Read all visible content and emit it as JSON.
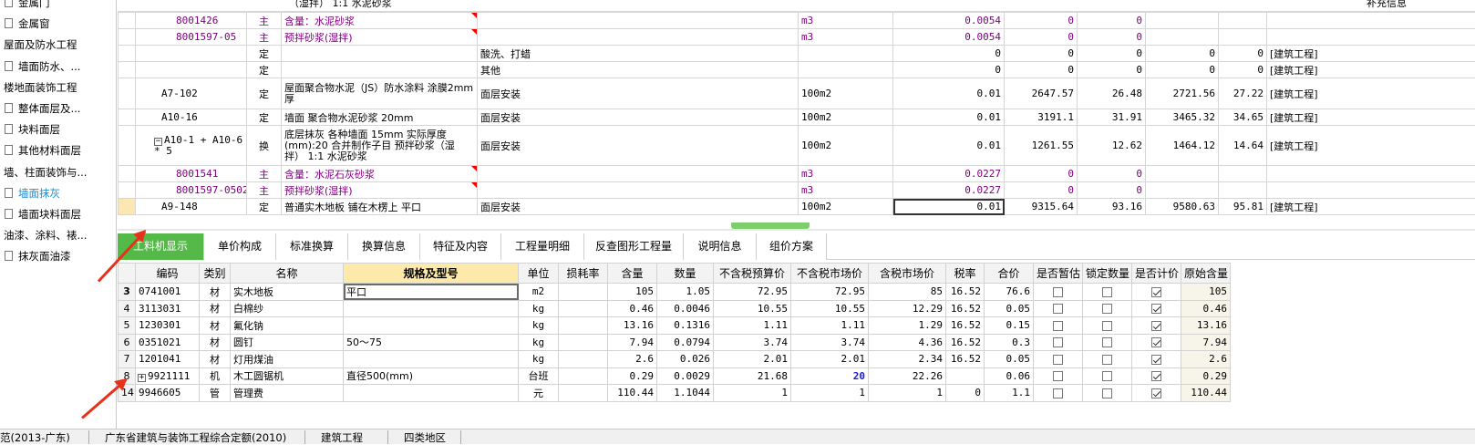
{
  "sidebar": {
    "items": [
      {
        "label": "金属门",
        "icon": true,
        "indent": true,
        "active": false
      },
      {
        "label": "金属窗",
        "icon": true,
        "indent": true,
        "active": false
      },
      {
        "label": "屋面及防水工程",
        "icon": false,
        "indent": false,
        "active": false
      },
      {
        "label": "墙面防水、...",
        "icon": true,
        "indent": true,
        "active": false
      },
      {
        "label": "楼地面装饰工程",
        "icon": false,
        "indent": false,
        "active": false
      },
      {
        "label": "整体面层及...",
        "icon": true,
        "indent": true,
        "active": false
      },
      {
        "label": "块料面层",
        "icon": true,
        "indent": true,
        "active": false
      },
      {
        "label": "其他材料面层",
        "icon": true,
        "indent": true,
        "active": false
      },
      {
        "label": "墙、柱面装饰与...",
        "icon": false,
        "indent": false,
        "active": false
      },
      {
        "label": "墙面抹灰",
        "icon": true,
        "indent": true,
        "active": true
      },
      {
        "label": "墙面块料面层",
        "icon": true,
        "indent": true,
        "active": false
      },
      {
        "label": "油漆、涂料、裱...",
        "icon": false,
        "indent": false,
        "active": false
      },
      {
        "label": "抹灰面油漆",
        "icon": true,
        "indent": true,
        "active": false
      }
    ]
  },
  "quota_grid": {
    "top_partial_text": "（湿拌） 1:1 水泥砂浆",
    "top_right_partial": "补充信息",
    "rows": [
      {
        "code": "8001426",
        "type": "主",
        "name": "含量：水泥砂浆",
        "feature": "",
        "unit": "m3",
        "qty": "0.0054",
        "price": "0",
        "sum": "0",
        "c1": "",
        "c2": "",
        "cat": "",
        "mat": true
      },
      {
        "code": "8001597-05",
        "type": "主",
        "name": "预拌砂浆(湿拌)",
        "feature": "",
        "unit": "m3",
        "qty": "0.0054",
        "price": "0",
        "sum": "0",
        "c1": "",
        "c2": "",
        "cat": "",
        "mat": true
      },
      {
        "code": "",
        "type": "定",
        "name": "",
        "feature": "酸洗、打蜡",
        "unit": "",
        "qty": "0",
        "price": "0",
        "sum": "0",
        "c1": "0",
        "c2": "0",
        "cat": "[建筑工程]",
        "mat": false
      },
      {
        "code": "",
        "type": "定",
        "name": "",
        "feature": "其他",
        "unit": "",
        "qty": "0",
        "price": "0",
        "sum": "0",
        "c1": "0",
        "c2": "0",
        "cat": "[建筑工程]",
        "mat": false
      },
      {
        "code": "A7-102",
        "type": "定",
        "name": "屋面聚合物水泥（JS）防水涂料 涂膜2mm厚",
        "feature": "面层安装",
        "unit": "100m2",
        "qty": "0.01",
        "price": "2647.57",
        "sum": "26.48",
        "c1": "2721.56",
        "c2": "27.22",
        "cat": "[建筑工程]",
        "mat": false
      },
      {
        "code": "A10-16",
        "type": "定",
        "name": "墙面 聚合物水泥砂浆 20mm",
        "feature": "面层安装",
        "unit": "100m2",
        "qty": "0.01",
        "price": "3191.1",
        "sum": "31.91",
        "c1": "3465.32",
        "c2": "34.65",
        "cat": "[建筑工程]",
        "mat": false
      },
      {
        "code": "A10-1 + A10-6 * 5",
        "type": "换",
        "name": "底层抹灰 各种墙面 15mm 实际厚度(mm):20 合并制作子目 预拌砂浆（湿拌） 1:1 水泥砂浆",
        "feature": "面层安装",
        "unit": "100m2",
        "qty": "0.01",
        "price": "1261.55",
        "sum": "12.62",
        "c1": "1464.12",
        "c2": "14.64",
        "cat": "[建筑工程]",
        "mat": false
      },
      {
        "code": "8001541",
        "type": "主",
        "name": "含量：水泥石灰砂浆",
        "feature": "",
        "unit": "m3",
        "qty": "0.0227",
        "price": "0",
        "sum": "0",
        "c1": "",
        "c2": "",
        "cat": "",
        "mat": true
      },
      {
        "code": "8001597-0502",
        "type": "主",
        "name": "预拌砂浆(湿拌)",
        "feature": "",
        "unit": "m3",
        "qty": "0.0227",
        "price": "0",
        "sum": "0",
        "c1": "",
        "c2": "",
        "cat": "",
        "mat": true
      },
      {
        "code": "A9-148",
        "type": "定",
        "name": "普通实木地板 铺在木楞上 平口",
        "feature": "面层安装",
        "unit": "100m2",
        "qty": "0.01",
        "price": "9315.64",
        "sum": "93.16",
        "c1": "9580.63",
        "c2": "95.81",
        "cat": "[建筑工程]",
        "mat": false
      }
    ]
  },
  "tabs": [
    "工料机显示",
    "单价构成",
    "标准换算",
    "换算信息",
    "特征及内容",
    "工程量明细",
    "反查图形工程量",
    "说明信息",
    "组价方案"
  ],
  "resource_table": {
    "headers": [
      "",
      "编码",
      "类别",
      "名称",
      "规格及型号",
      "单位",
      "损耗率",
      "含量",
      "数量",
      "不含税预算价",
      "不含税市场价",
      "含税市场价",
      "税率",
      "合价",
      "是否暂估",
      "锁定数量",
      "是否计价",
      "原始含量"
    ],
    "rows": [
      {
        "n": "3",
        "code": "0741001",
        "cat": "材",
        "name": "实木地板",
        "spec": "平口",
        "unit": "m2",
        "loss": "",
        "content": "105",
        "qty": "1.05",
        "budget": "72.95",
        "market": "72.95",
        "taxm": "85",
        "tax": "16.52",
        "total": "76.6",
        "est": false,
        "lock": false,
        "priced": true,
        "orig": "105"
      },
      {
        "n": "4",
        "code": "3113031",
        "cat": "材",
        "name": "白棉纱",
        "spec": "",
        "unit": "kg",
        "loss": "",
        "content": "0.46",
        "qty": "0.0046",
        "budget": "10.55",
        "market": "10.55",
        "taxm": "12.29",
        "tax": "16.52",
        "total": "0.05",
        "est": false,
        "lock": false,
        "priced": true,
        "orig": "0.46"
      },
      {
        "n": "5",
        "code": "1230301",
        "cat": "材",
        "name": "氟化钠",
        "spec": "",
        "unit": "kg",
        "loss": "",
        "content": "13.16",
        "qty": "0.1316",
        "budget": "1.11",
        "market": "1.11",
        "taxm": "1.29",
        "tax": "16.52",
        "total": "0.15",
        "est": false,
        "lock": false,
        "priced": true,
        "orig": "13.16"
      },
      {
        "n": "6",
        "code": "0351021",
        "cat": "材",
        "name": "圆钉",
        "spec": "50～75",
        "unit": "kg",
        "loss": "",
        "content": "7.94",
        "qty": "0.0794",
        "budget": "3.74",
        "market": "3.74",
        "taxm": "4.36",
        "tax": "16.52",
        "total": "0.3",
        "est": false,
        "lock": false,
        "priced": true,
        "orig": "7.94"
      },
      {
        "n": "7",
        "code": "1201041",
        "cat": "材",
        "name": "灯用煤油",
        "spec": "",
        "unit": "kg",
        "loss": "",
        "content": "2.6",
        "qty": "0.026",
        "budget": "2.01",
        "market": "2.01",
        "taxm": "2.34",
        "tax": "16.52",
        "total": "0.05",
        "est": false,
        "lock": false,
        "priced": true,
        "orig": "2.6"
      },
      {
        "n": "8",
        "code": "9921111",
        "cat": "机",
        "name": "木工圆锯机",
        "spec": "直径500(mm)",
        "unit": "台班",
        "loss": "",
        "content": "0.29",
        "qty": "0.0029",
        "budget": "21.68",
        "market": "20",
        "taxm": "22.26",
        "tax": "",
        "total": "0.06",
        "est": false,
        "lock": false,
        "priced": true,
        "orig": "0.29",
        "expand": true
      },
      {
        "n": "14",
        "code": "9946605",
        "cat": "管",
        "name": "管理费",
        "spec": "",
        "unit": "元",
        "loss": "",
        "content": "110.44",
        "qty": "1.1044",
        "budget": "1",
        "market": "1",
        "taxm": "1",
        "tax": "0",
        "total": "1.1",
        "est": false,
        "lock": false,
        "priced": true,
        "orig": "110.44"
      }
    ]
  },
  "status_bar": [
    "范(2013-广东)",
    "广东省建筑与装饰工程综合定额(2010)",
    "建筑工程",
    "四类地区"
  ],
  "colors": {
    "accent": "#54b948",
    "material": "#800080",
    "highlight_value": "#1a1ad8",
    "arrow": "#e8311a",
    "sidebar_active": "#1e8fd6"
  }
}
